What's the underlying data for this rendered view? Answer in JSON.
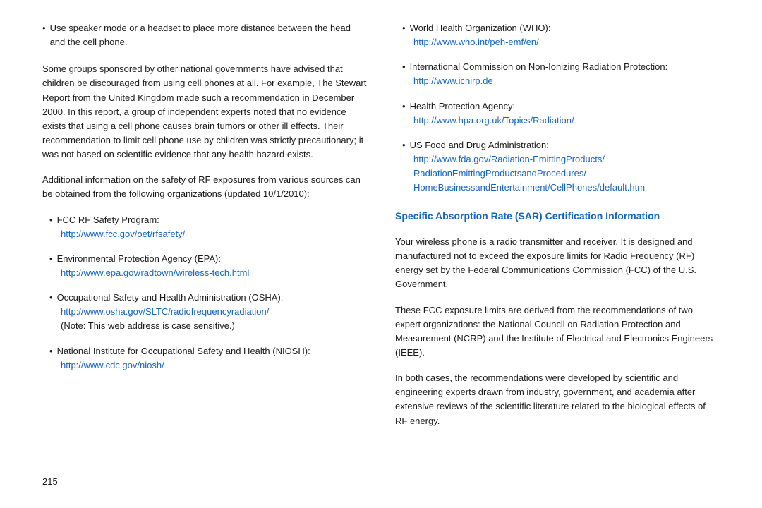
{
  "page": {
    "number": "215",
    "left": {
      "top_bullet": {
        "dot": "•",
        "text": "Use speaker mode or a headset to place more distance between the head and the cell phone."
      },
      "paragraph1": "Some groups sponsored by other national governments have advised that children be discouraged from using cell phones at all. For example, The Stewart Report from the United Kingdom made such a recommendation in December 2000. In this report, a group of independent experts noted that no evidence exists that using a cell phone causes brain tumors or other ill effects. Their recommendation to limit cell phone use by children was strictly precautionary; it was not based on scientific evidence that any health hazard exists.",
      "paragraph2": "Additional information on the safety of RF exposures from various sources can be obtained from the following organizations (updated 10/1/2010):",
      "bullets": [
        {
          "id": "bullet1",
          "dot": "•",
          "label": "FCC RF Safety Program:",
          "link": "http://www.fcc.gov/oet/rfsafety/",
          "note": ""
        },
        {
          "id": "bullet2",
          "dot": "•",
          "label": "Environmental Protection Agency (EPA):",
          "link": "http://www.epa.gov/radtown/wireless-tech.html",
          "note": ""
        },
        {
          "id": "bullet3",
          "dot": "•",
          "label": "Occupational Safety and Health Administration (OSHA):",
          "link": "http://www.osha.gov/SLTC/radiofrequencyradiation/",
          "note": "(Note: This web address is case sensitive.)"
        },
        {
          "id": "bullet4",
          "dot": "•",
          "label": "National Institute for Occupational Safety and Health (NIOSH):",
          "link": "http://www.cdc.gov/niosh/",
          "note": ""
        }
      ]
    },
    "right": {
      "bullets": [
        {
          "id": "rbullet1",
          "dot": "•",
          "label": "World Health Organization (WHO):",
          "link": "http://www.who.int/peh-emf/en/",
          "note": ""
        },
        {
          "id": "rbullet2",
          "dot": "•",
          "label": "International Commission on Non-Ionizing Radiation Protection:",
          "link": "http://www.icnirp.de",
          "note": ""
        },
        {
          "id": "rbullet3",
          "dot": "•",
          "label": "Health Protection Agency:",
          "link": "http://www.hpa.org.uk/Topics/Radiation/",
          "note": ""
        },
        {
          "id": "rbullet4",
          "dot": "•",
          "label": "US Food and Drug Administration:",
          "link_lines": [
            "http://www.fda.gov/Radiation-EmittingProducts/",
            "RadiationEmittingProductsandProcedures/",
            "HomeBusinessandEntertainment/CellPhones/default.htm"
          ],
          "note": ""
        }
      ],
      "section_heading": "Specific Absorption Rate (SAR) Certification Information",
      "paragraphs": [
        "Your wireless phone is a radio transmitter and receiver. It is designed and manufactured not to exceed the exposure limits for Radio Frequency (RF) energy set by the Federal Communications Commission (FCC) of the U.S. Government.",
        "These FCC exposure limits are derived from the recommendations of two expert organizations: the National Council on Radiation Protection and Measurement (NCRP) and the Institute of Electrical and Electronics Engineers (IEEE).",
        "In both cases, the recommendations were developed by scientific and engineering experts drawn from industry, government, and academia after extensive reviews of the scientific literature related to the biological effects of RF energy."
      ]
    }
  }
}
